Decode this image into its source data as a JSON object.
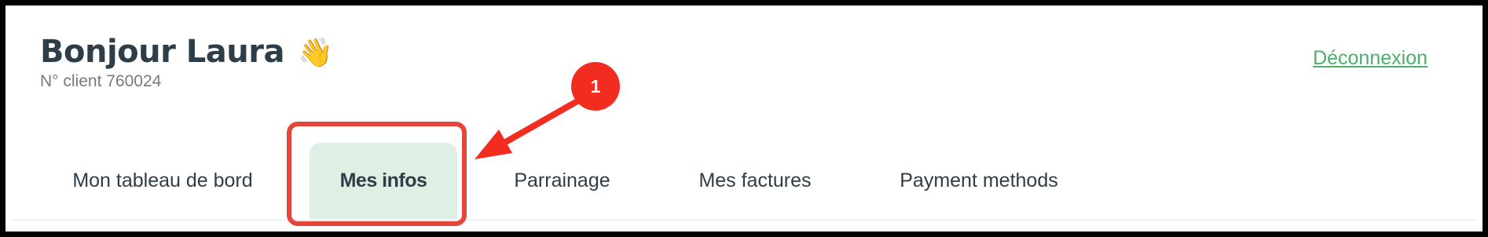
{
  "header": {
    "greeting": "Bonjour Laura",
    "greeting_emoji": "👋",
    "client_number": "N° client 760024",
    "logout_label": "Déconnexion"
  },
  "tabs": [
    {
      "label": "Mon tableau de bord",
      "active": false
    },
    {
      "label": "Mes infos",
      "active": true
    },
    {
      "label": "Parrainage",
      "active": false
    },
    {
      "label": "Mes factures",
      "active": false
    },
    {
      "label": "Payment methods",
      "active": false
    }
  ],
  "annotation": {
    "step_number": "1",
    "color": "#f22c1f"
  },
  "colors": {
    "text_dark": "#2e3e48",
    "link_green": "#4caf6e",
    "active_tab_bg": "#e0efe4",
    "highlight_red": "#e4463c"
  }
}
